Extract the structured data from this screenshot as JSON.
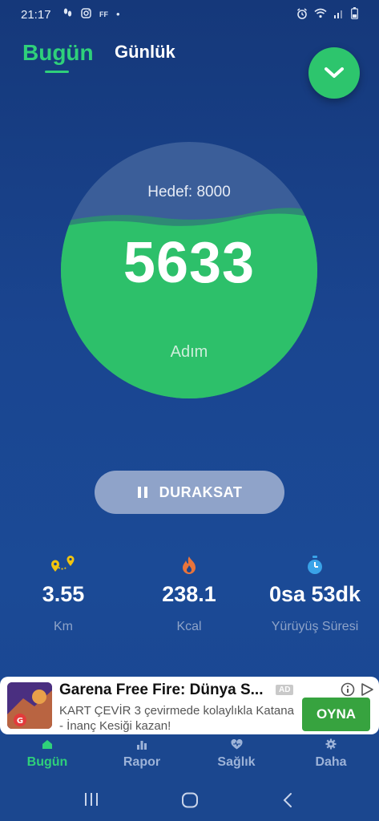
{
  "status_bar": {
    "time": "21:17",
    "left_icons": [
      "steps-icon",
      "instagram-icon",
      "ff-icon",
      "dot-icon"
    ],
    "ff_text": "FF",
    "right_icons": [
      "alarm-icon",
      "wifi-icon",
      "signal-icon",
      "battery-icon"
    ]
  },
  "header": {
    "tabs": [
      {
        "label": "Bugün",
        "active": true
      },
      {
        "label": "Günlük",
        "active": false
      }
    ]
  },
  "progress": {
    "goal_text": "Hedef: 8000",
    "steps": "5633",
    "unit": "Adım",
    "fill_fraction": 0.704
  },
  "pause_button": {
    "label": "DURAKSAT"
  },
  "stats": [
    {
      "value": "3.55",
      "label": "Km",
      "icon": "location-pins-icon"
    },
    {
      "value": "238.1",
      "label": "Kcal",
      "icon": "flame-icon"
    },
    {
      "value": "0sa 53dk",
      "label": "Yürüyüş Süresi",
      "icon": "stopwatch-icon"
    }
  ],
  "ad": {
    "title": "Garena Free Fire: Dünya S...",
    "tag": "AD",
    "description": "KART ÇEVİR 3 çevirmede kolaylıkla Katana - İnanç Kesiği kazan!",
    "cta": "OYNA"
  },
  "bottom_nav": [
    {
      "label": "Bugün",
      "icon": "home-icon",
      "active": true
    },
    {
      "label": "Rapor",
      "icon": "bar-chart-icon",
      "active": false
    },
    {
      "label": "Sağlık",
      "icon": "heart-icon",
      "active": false
    },
    {
      "label": "Daha",
      "icon": "gear-icon",
      "active": false
    }
  ],
  "colors": {
    "accent": "#2fd07a",
    "background": "#1a4590",
    "circle_fill": "#2dc06a",
    "inactive_nav": "#9db3d8"
  }
}
